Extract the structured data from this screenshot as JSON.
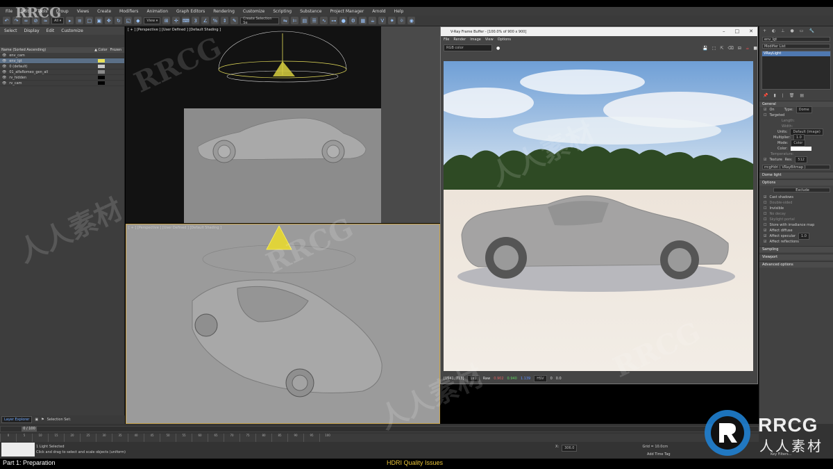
{
  "app": {
    "menus": [
      "File",
      "Edit",
      "Tools",
      "Group",
      "Views",
      "Create",
      "Modifiers",
      "Animation",
      "Graph Editors",
      "Rendering",
      "Customize",
      "Scripting",
      "Substance",
      "Project Manager",
      "Arnold",
      "Help"
    ],
    "selection_set_placeholder": "Create Selection Se"
  },
  "scene_explorer": {
    "menus": [
      "Select",
      "Display",
      "Edit",
      "Customize"
    ],
    "column_name": "Name (Sorted Ascending)",
    "column_color": "▲ Color",
    "column_frozen": "Frozen",
    "rows": [
      {
        "name": "env_cam",
        "color": "#3d3d3d",
        "selected": false
      },
      {
        "name": "env_lgt",
        "color": "#e8e05a",
        "selected": true
      },
      {
        "name": "0 (default)",
        "color": "#c8c8c8",
        "selected": false
      },
      {
        "name": "01_alfaRomeo_gen_all",
        "color": "#8a8a8a",
        "selected": false
      },
      {
        "name": "rv_hidden",
        "color": "#000000",
        "selected": false
      },
      {
        "name": "rv_cam",
        "color": "#000000",
        "selected": false
      }
    ],
    "layer_explorer_label": "Layer Explorer",
    "selection_set_label": "Selection Set:"
  },
  "viewports": {
    "top_label": "[ + ] [Perspective ] [User Defined ] [Default Shading ]",
    "persp_label": "[ + ] [Perspective ] [User Defined ] [Default Shading ]"
  },
  "vfb": {
    "title": "V-Ray Frame Buffer - [100.0% of 900 x 900]",
    "menus": [
      "File",
      "Render",
      "Image",
      "View",
      "Options"
    ],
    "channel": "RGB color",
    "coords": "[1541, 713]",
    "zoom": "1x1",
    "raw_label": "Raw",
    "values": [
      "0.902",
      "0.940",
      "1.139"
    ],
    "mode": "HSV",
    "extra": [
      "0",
      "0.0"
    ]
  },
  "command_panel": {
    "object_name": "env_lgt",
    "modifier_list": "Modifier List",
    "stack_item": "VRayLight",
    "rollouts": [
      "General",
      "Viewport",
      "Sampling",
      "Advanced options",
      "Dome light",
      "Options"
    ],
    "general": {
      "on": "On",
      "type_label": "Type:",
      "type_value": "Dome",
      "targeted": "Targeted",
      "length_label": "Length:",
      "width_label": "Width:",
      "units_label": "Units:",
      "units_value": "Default (image)",
      "multiplier_label": "Multiplier:",
      "multiplier_value": "1.0",
      "mode_label": "Mode:",
      "mode_value": "Color",
      "color_label": "Color:",
      "temperature_label": "Temperature:",
      "texture_label": "Texture",
      "res_label": "Res:",
      "res_value": "512",
      "texmap": "rrcgHdri ( VRayBitmap )"
    },
    "options": {
      "exclude_btn": "Exclude",
      "items": [
        "Cast shadows",
        "Double-sided",
        "Invisible",
        "No decay",
        "Skylight portal",
        "Store with irradiance map",
        "Affect diffuse",
        "Affect specular",
        "Affect reflections"
      ],
      "specular_value": "1.0"
    }
  },
  "timeline": {
    "frame": "0 / 100",
    "ticks": [
      "0",
      "5",
      "10",
      "15",
      "20",
      "25",
      "30",
      "35",
      "40",
      "45",
      "50",
      "55",
      "60",
      "65",
      "70",
      "75",
      "80",
      "85",
      "90",
      "95",
      "100"
    ]
  },
  "status": {
    "line1": "1 Light Selected",
    "line2": "Click and drag to select and scale objects (uniform)",
    "x_label": "X:",
    "x_value": "306.0",
    "grid": "Grid = 10.0cm",
    "add_time_tag": "Add Time Tag",
    "key_filters": "Key Filters..."
  },
  "watermarks": {
    "rrcg": "RRCG",
    "cn": "人人素材",
    "logo_text": "RRCG",
    "logo_sub": "人人素材"
  },
  "course": {
    "part": "Part 1: Preparation",
    "section": "HDRI Quality Issues"
  }
}
